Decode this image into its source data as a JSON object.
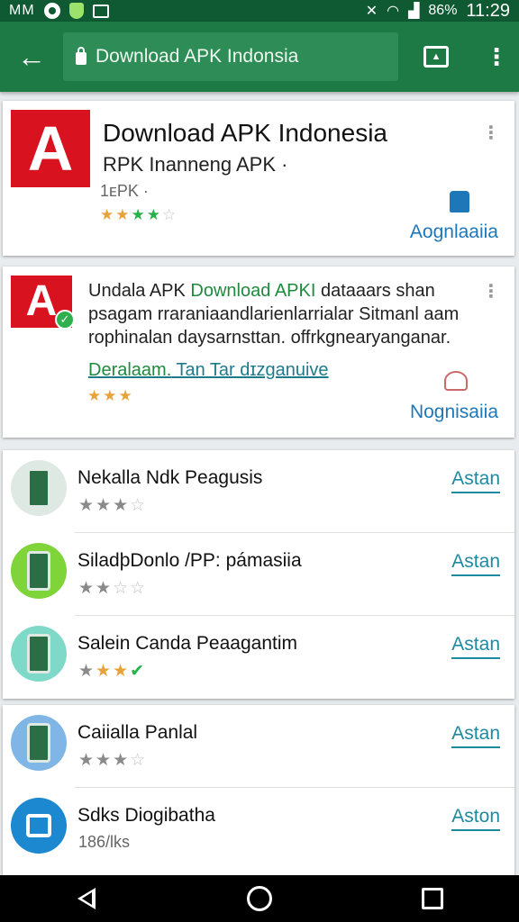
{
  "status_bar": {
    "carrier": "MM",
    "battery": "86%",
    "time": "11:29"
  },
  "toolbar": {
    "url": "Download APK Indonsia",
    "tabs_count": ""
  },
  "featured": {
    "title": "Download APK Indonesia",
    "subtitle": "RPK Inanneng APK ·",
    "meta": "1ᴇPK ·",
    "rating_stars": 4,
    "action": "Aognlaaiia"
  },
  "promo": {
    "text_prefix": "Undala APK ",
    "text_highlight": "Download APKI",
    "text_rest": " dataaars shan psagam rraraniaandlarienlarrialar Sitmanl aam rophinalan daysarnsttan. offrkgnearyanganar.",
    "link_part1": "Deralaam.",
    "link_part2": " Tan Tar dɪzganuive",
    "rating_stars": 3,
    "action": "Nognisaiia"
  },
  "apps_group1": [
    {
      "title": "Nekalla Ndk Peagusis",
      "install": "Astan",
      "stars": 3
    },
    {
      "title": "SiladþDonlo /PP: pámasiia",
      "install": "Astan",
      "stars": 2
    },
    {
      "title": "Salein Canda Peaagantim",
      "install": "Astan",
      "stars": 3
    }
  ],
  "apps_group2": [
    {
      "title": "Caiialla Panlal",
      "install": "Astan",
      "stars": 3
    },
    {
      "title": "Sdks Diogibatha",
      "install": "Aston",
      "meta": "186/lks"
    }
  ],
  "colors": {
    "toolbar": "#1d7a45",
    "status_bar": "#0f5a32",
    "brand_red": "#d8131f",
    "link_blue": "#1d77b8",
    "install_teal": "#1e8aa0"
  }
}
